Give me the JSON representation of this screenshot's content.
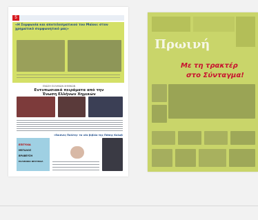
{
  "left_page": {
    "badge": "5",
    "top_caption": "«Η Συμφωνία και αποτελεσματικού του Μαϊου: στον χρηματικό συμφωνητικό μας»",
    "mid_kicker": "ΕΝΩΣΗ ΕΛΛΗΝΩΝ ΧΗΜΙΚΩΝ",
    "mid_headline": "Εντυπωσιακά πειράματα από την Ένωση Ελλήνων Χημικών",
    "lower_headline": "«Εικόνες Πολίτη» το νέο βιβλίο της Πόπης Κολοβού",
    "promo_lines": [
      "ΕΠΙΤΥΧΙΑ",
      "ΜΕΓΑΛΟΣ",
      "ΒΡΑΒΕΥΣΗ",
      "ΕΛΛΗΝΙΚΟ ΦΕΣΤΙΒΑΛ"
    ]
  },
  "right_page": {
    "masthead": "Πρωινή",
    "headline_line1": "Με τη τρακτέρ",
    "headline_line2": "στο Σύνταγμα!"
  }
}
